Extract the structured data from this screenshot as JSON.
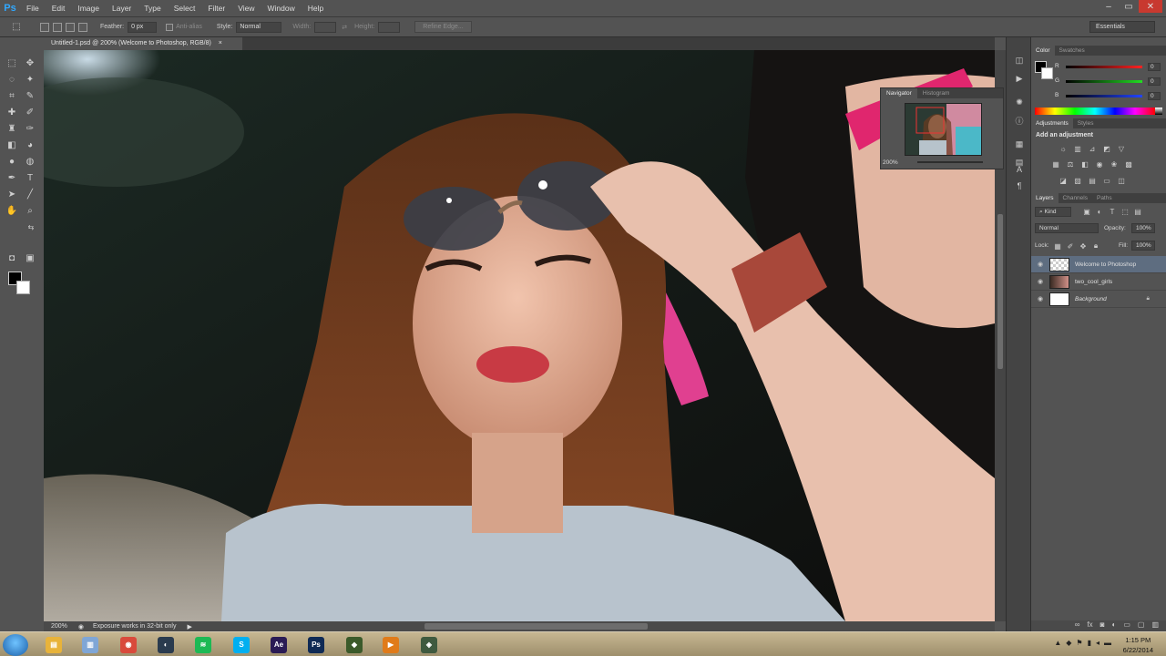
{
  "app": {
    "logo": "Ps"
  },
  "menu": [
    "File",
    "Edit",
    "Image",
    "Layer",
    "Type",
    "Select",
    "Filter",
    "View",
    "Window",
    "Help"
  ],
  "window_controls": {
    "minimize": "–",
    "restore": "▭",
    "close": "✕"
  },
  "options_bar": {
    "feather_label": "Feather:",
    "feather_value": "0 px",
    "antialias_label": "Anti-alias",
    "style_label": "Style:",
    "style_value": "Normal",
    "width_label": "Width:",
    "height_label": "Height:",
    "refine_edge": "Refine Edge...",
    "workspace": "Essentials"
  },
  "document": {
    "tab_title": "Untitled-1.psd @ 200% (Welcome to Photoshop, RGB/8)",
    "tab_close": "×"
  },
  "status_bar": {
    "zoom": "200%",
    "message": "Exposure works in 32-bit only",
    "arrow": "▶"
  },
  "navigator": {
    "tabs": [
      "Navigator",
      "Histogram"
    ],
    "zoom": "200%"
  },
  "color_panel": {
    "tabs": [
      "Color",
      "Swatches"
    ],
    "channels": [
      {
        "label": "R",
        "value": "0",
        "color": "#ff2a2a"
      },
      {
        "label": "G",
        "value": "0",
        "color": "#2ad12a"
      },
      {
        "label": "B",
        "value": "0",
        "color": "#2a4fff"
      }
    ]
  },
  "adjustments_panel": {
    "tabs": [
      "Adjustments",
      "Styles"
    ],
    "heading": "Add an adjustment"
  },
  "layers_panel": {
    "tabs": [
      "Layers",
      "Channels",
      "Paths"
    ],
    "kind_filter": "Kind",
    "blend_mode": "Normal",
    "opacity_label": "Opacity:",
    "opacity_value": "100%",
    "lock_label": "Lock:",
    "fill_label": "Fill:",
    "fill_value": "100%",
    "layers": [
      {
        "name": "Welcome to Photoshop",
        "selected": true
      },
      {
        "name": "two_cool_girls",
        "selected": false
      },
      {
        "name": "Background",
        "selected": false,
        "locked": true
      }
    ]
  },
  "taskbar": {
    "apps": [
      {
        "name": "explorer",
        "glyph": "▤",
        "color": "#e8b33a"
      },
      {
        "name": "files",
        "glyph": "▥",
        "color": "#7fa6d6"
      },
      {
        "name": "chrome",
        "glyph": "◉",
        "color": "#d94a3c"
      },
      {
        "name": "steam",
        "glyph": "◐",
        "color": "#2a3b4e"
      },
      {
        "name": "spotify",
        "glyph": "≋",
        "color": "#1db954"
      },
      {
        "name": "skype",
        "glyph": "S",
        "color": "#00aff0"
      },
      {
        "name": "after-effects",
        "glyph": "Ae",
        "color": "#2a1b55"
      },
      {
        "name": "photoshop",
        "glyph": "Ps",
        "color": "#0f2a55"
      },
      {
        "name": "app-green",
        "glyph": "◆",
        "color": "#3b5a2a"
      },
      {
        "name": "media",
        "glyph": "▶",
        "color": "#e07b1a"
      },
      {
        "name": "app-tool",
        "glyph": "◈",
        "color": "#3f5a3f"
      }
    ],
    "time": "1:15 PM",
    "date": "6/22/2014"
  }
}
